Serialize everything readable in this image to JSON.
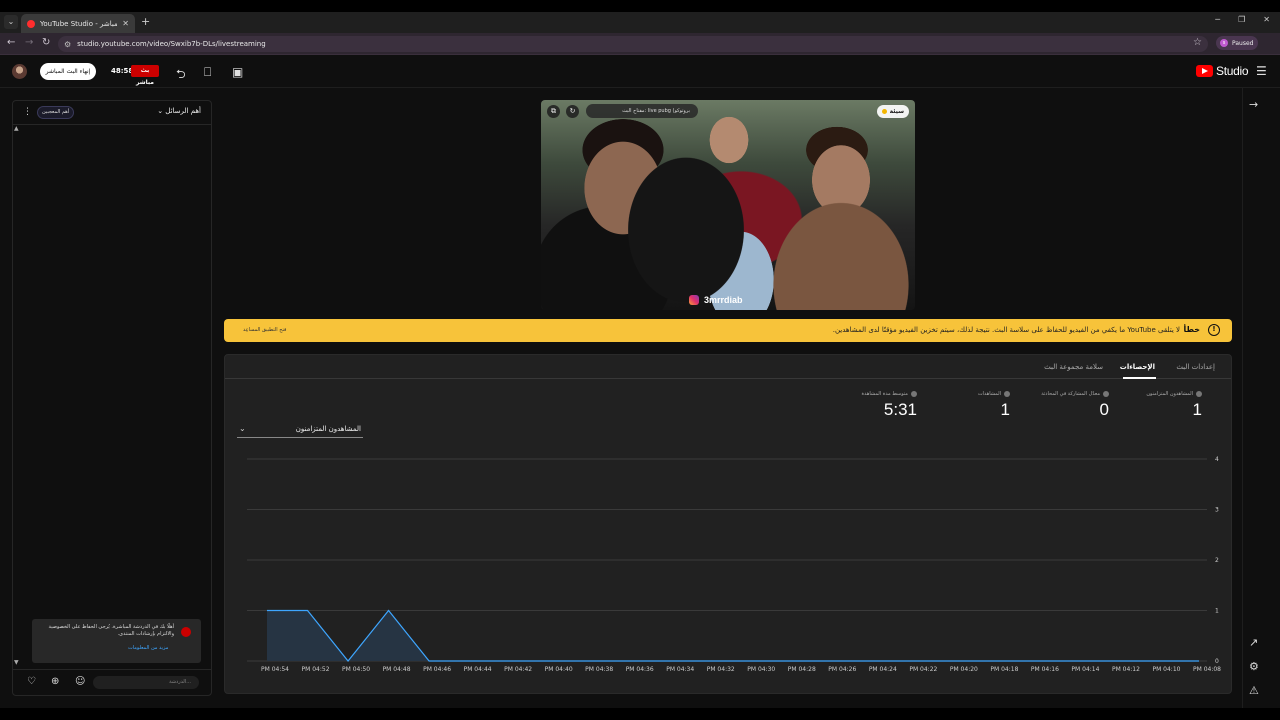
{
  "browser": {
    "tab_title": "YouTube Studio - البث المباشر",
    "url": "studio.youtube.com/video/Swxib7b-DLs/livestreaming",
    "profile_status": "Paused",
    "profile_initial": "s"
  },
  "header": {
    "end_stream_label": "إنهاء البث المباشر",
    "timer": "48:58",
    "live_badge": "بث مباشر",
    "logo_text": "Studio"
  },
  "chat": {
    "top_fans_label": "أهم المعجبين",
    "mode_label": "أهم الرسائل",
    "info_text": "أهلًا بك في الدردشة المباشرة. يُرجى الحفاظ على الخصوصية والالتزام بإرشادات المنتدى.",
    "info_link": "مزيد من المعلومات",
    "input_placeholder": "الدردشة..."
  },
  "video": {
    "status_label": "سيئة",
    "stream_key_label": "مفتاح البث: live pubg (بروتوكو",
    "watermark": "3mrrdiab"
  },
  "warning": {
    "title": "خطأ",
    "text": "لا يتلقى YouTube ما يكفي من الفيديو للحفاظ على سلاسة البث. نتيجة لذلك، سيتم تخزين الفيديو مؤقتًا لدى المشاهدين.",
    "action": "فتح التطبيق المساعِد"
  },
  "analytics": {
    "tabs": [
      "إعدادات البث",
      "الإحصاءات",
      "سلامة مجموعة البث"
    ],
    "active_tab": 1,
    "metrics": [
      {
        "label": "المشاهدون المتزامنون",
        "value": "1"
      },
      {
        "label": "معدّل المشاركة في المحادثة",
        "value": "0"
      },
      {
        "label": "المشاهدات",
        "value": "1"
      },
      {
        "label": "متوسط مدة المشاهدة",
        "value": "5:31"
      }
    ],
    "selector_label": "المشاهدون المتزامنون"
  },
  "chart_data": {
    "type": "area",
    "x": [
      "PM 04:54",
      "PM 04:52",
      "PM 04:50",
      "PM 04:48",
      "PM 04:46",
      "PM 04:44",
      "PM 04:42",
      "PM 04:40",
      "PM 04:38",
      "PM 04:36",
      "PM 04:34",
      "PM 04:32",
      "PM 04:30",
      "PM 04:28",
      "PM 04:26",
      "PM 04:24",
      "PM 04:22",
      "PM 04:20",
      "PM 04:18",
      "PM 04:16",
      "PM 04:14",
      "PM 04:12",
      "PM 04:10",
      "PM 04:08"
    ],
    "series": [
      {
        "values": [
          1,
          1,
          0,
          1,
          0,
          0,
          0,
          0,
          0,
          0,
          0,
          0,
          0,
          0,
          0,
          0,
          0,
          0,
          0,
          0,
          0,
          0,
          0,
          0
        ]
      }
    ],
    "yticks": [
      0,
      1,
      2,
      3,
      4
    ],
    "ylim": [
      0,
      4
    ],
    "title": "",
    "xlabel": "",
    "ylabel": "",
    "grid": true,
    "y_axis_side": "right",
    "line_color": "#3ea6ff",
    "fill_color": "#263443"
  }
}
